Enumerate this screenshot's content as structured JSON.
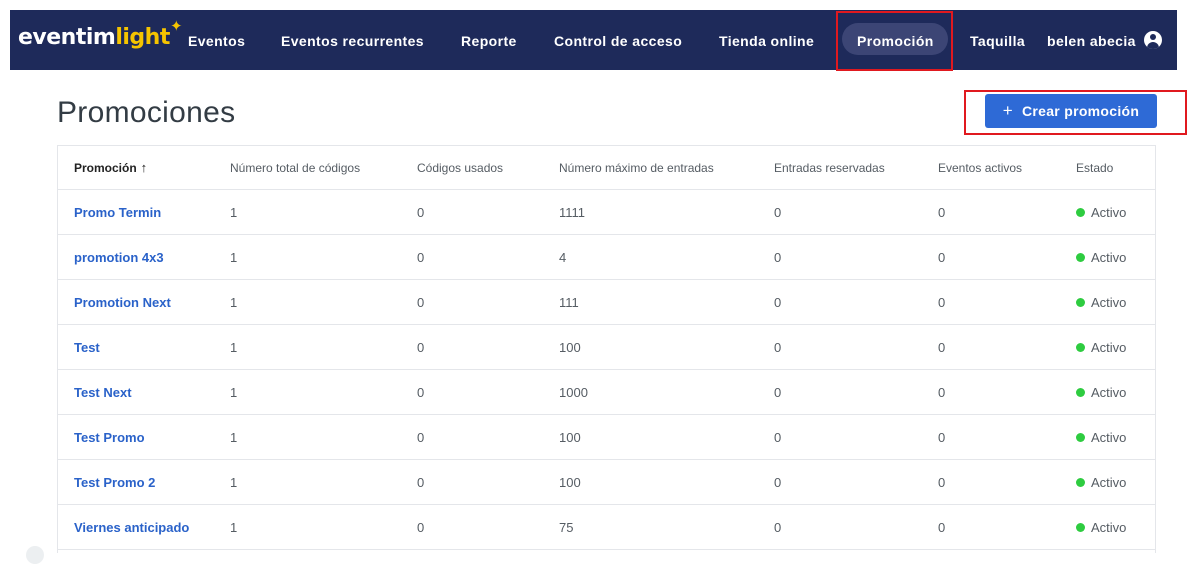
{
  "header": {
    "logo_part1": "eventim",
    "logo_part2": "light",
    "logo_star": "✦",
    "nav": [
      "Eventos",
      "Eventos recurrentes",
      "Reporte",
      "Control de acceso",
      "Tienda online",
      "Promoción",
      "Taquilla"
    ],
    "active_nav": "Promoción",
    "user_name": "belen abecia",
    "user_icon": "user-circle-icon",
    "bg_color": "#1e2a5a",
    "logo_accent": "#f5c400"
  },
  "page": {
    "title": "Promociones",
    "create_button": {
      "icon": "+",
      "label": "Crear promoción"
    }
  },
  "table": {
    "columns": [
      "Promoción",
      "Número total de códigos",
      "Códigos usados",
      "Número máximo de entradas",
      "Entradas reservadas",
      "Eventos activos",
      "Estado"
    ],
    "sort_indicator": "↑",
    "rows": [
      [
        "Promo Termin",
        "1",
        "0",
        "1111",
        "0",
        "0",
        "Activo"
      ],
      [
        "promotion 4x3",
        "1",
        "0",
        "4",
        "0",
        "0",
        "Activo"
      ],
      [
        "Promotion Next",
        "1",
        "0",
        "111",
        "0",
        "0",
        "Activo"
      ],
      [
        "Test",
        "1",
        "0",
        "100",
        "0",
        "0",
        "Activo"
      ],
      [
        "Test Next",
        "1",
        "0",
        "1000",
        "0",
        "0",
        "Activo"
      ],
      [
        "Test Promo",
        "1",
        "0",
        "100",
        "0",
        "0",
        "Activo"
      ],
      [
        "Test Promo 2",
        "1",
        "0",
        "100",
        "0",
        "0",
        "Activo"
      ],
      [
        "Viernes anticipado",
        "1",
        "0",
        "75",
        "0",
        "0",
        "Activo"
      ]
    ],
    "status_color": "#2ecc40",
    "link_color": "#2a62c9"
  },
  "annotations": {
    "highlight_color": "#e0191f"
  }
}
